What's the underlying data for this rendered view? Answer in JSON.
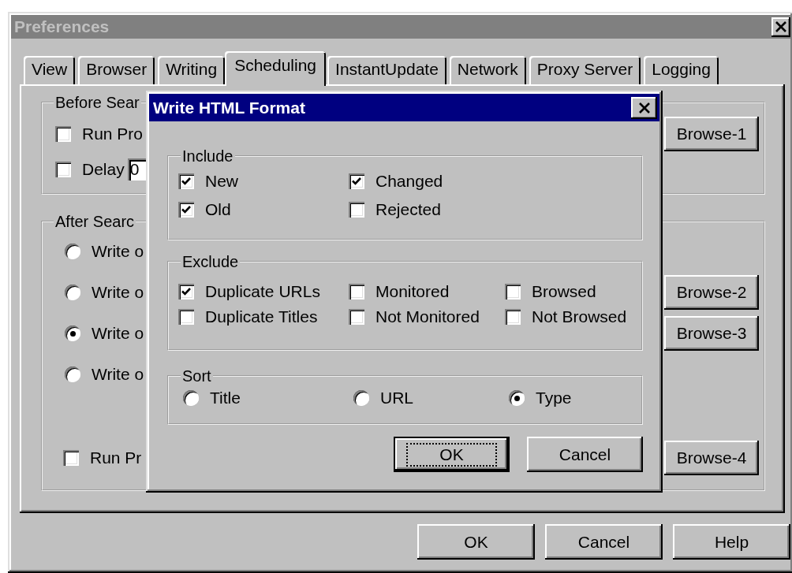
{
  "window": {
    "title": "Preferences"
  },
  "tabs": [
    {
      "label": "View",
      "selected": false
    },
    {
      "label": "Browser",
      "selected": false
    },
    {
      "label": "Writing",
      "selected": false
    },
    {
      "label": "Scheduling",
      "selected": true
    },
    {
      "label": "InstantUpdate",
      "selected": false
    },
    {
      "label": "Network",
      "selected": false
    },
    {
      "label": "Proxy Server",
      "selected": false
    },
    {
      "label": "Logging",
      "selected": false
    }
  ],
  "before_search": {
    "title": "Before Sear",
    "rows": [
      {
        "kind": "checkbox",
        "label": "Run Pro",
        "checked": false,
        "button": "Browse-1"
      },
      {
        "kind": "checkbox",
        "label": "Delay",
        "checked": false,
        "value": "0"
      }
    ]
  },
  "after_search": {
    "title": "After Searc",
    "rows": [
      {
        "kind": "radio",
        "label": "Write o",
        "selected": false
      },
      {
        "kind": "radio",
        "label": "Write o",
        "selected": false,
        "button": "Browse-2"
      },
      {
        "kind": "radio",
        "label": "Write o",
        "selected": true,
        "button": "Browse-3"
      },
      {
        "kind": "radio",
        "label": "Write o",
        "selected": false
      },
      {
        "kind": "checkbox",
        "label": "Run Pr",
        "checked": false,
        "button": "Browse-4"
      }
    ]
  },
  "buttons": [
    {
      "label": "OK",
      "default": false
    },
    {
      "label": "Cancel",
      "default": false
    },
    {
      "label": "Help",
      "default": false
    }
  ],
  "dialog": {
    "title": "Write HTML Format",
    "include": {
      "title": "Include",
      "rows": [
        [
          {
            "label": "New",
            "checked": true
          },
          {
            "label": "Changed",
            "checked": true
          }
        ],
        [
          {
            "label": "Old",
            "checked": true
          },
          {
            "label": "Rejected",
            "checked": false
          }
        ]
      ]
    },
    "exclude": {
      "title": "Exclude",
      "rows": [
        [
          {
            "label": "Duplicate URLs",
            "checked": true
          },
          {
            "label": "Monitored",
            "checked": false
          },
          {
            "label": "Browsed",
            "checked": false
          }
        ],
        [
          {
            "label": "Duplicate Titles",
            "checked": false
          },
          {
            "label": "Not Monitored",
            "checked": false
          },
          {
            "label": "Not Browsed",
            "checked": false
          }
        ]
      ]
    },
    "sort": {
      "title": "Sort",
      "options": [
        {
          "label": "Title",
          "selected": false
        },
        {
          "label": "URL",
          "selected": false
        },
        {
          "label": "Type",
          "selected": true
        }
      ]
    },
    "buttons": [
      {
        "label": "OK",
        "default": true
      },
      {
        "label": "Cancel",
        "default": false
      }
    ]
  }
}
